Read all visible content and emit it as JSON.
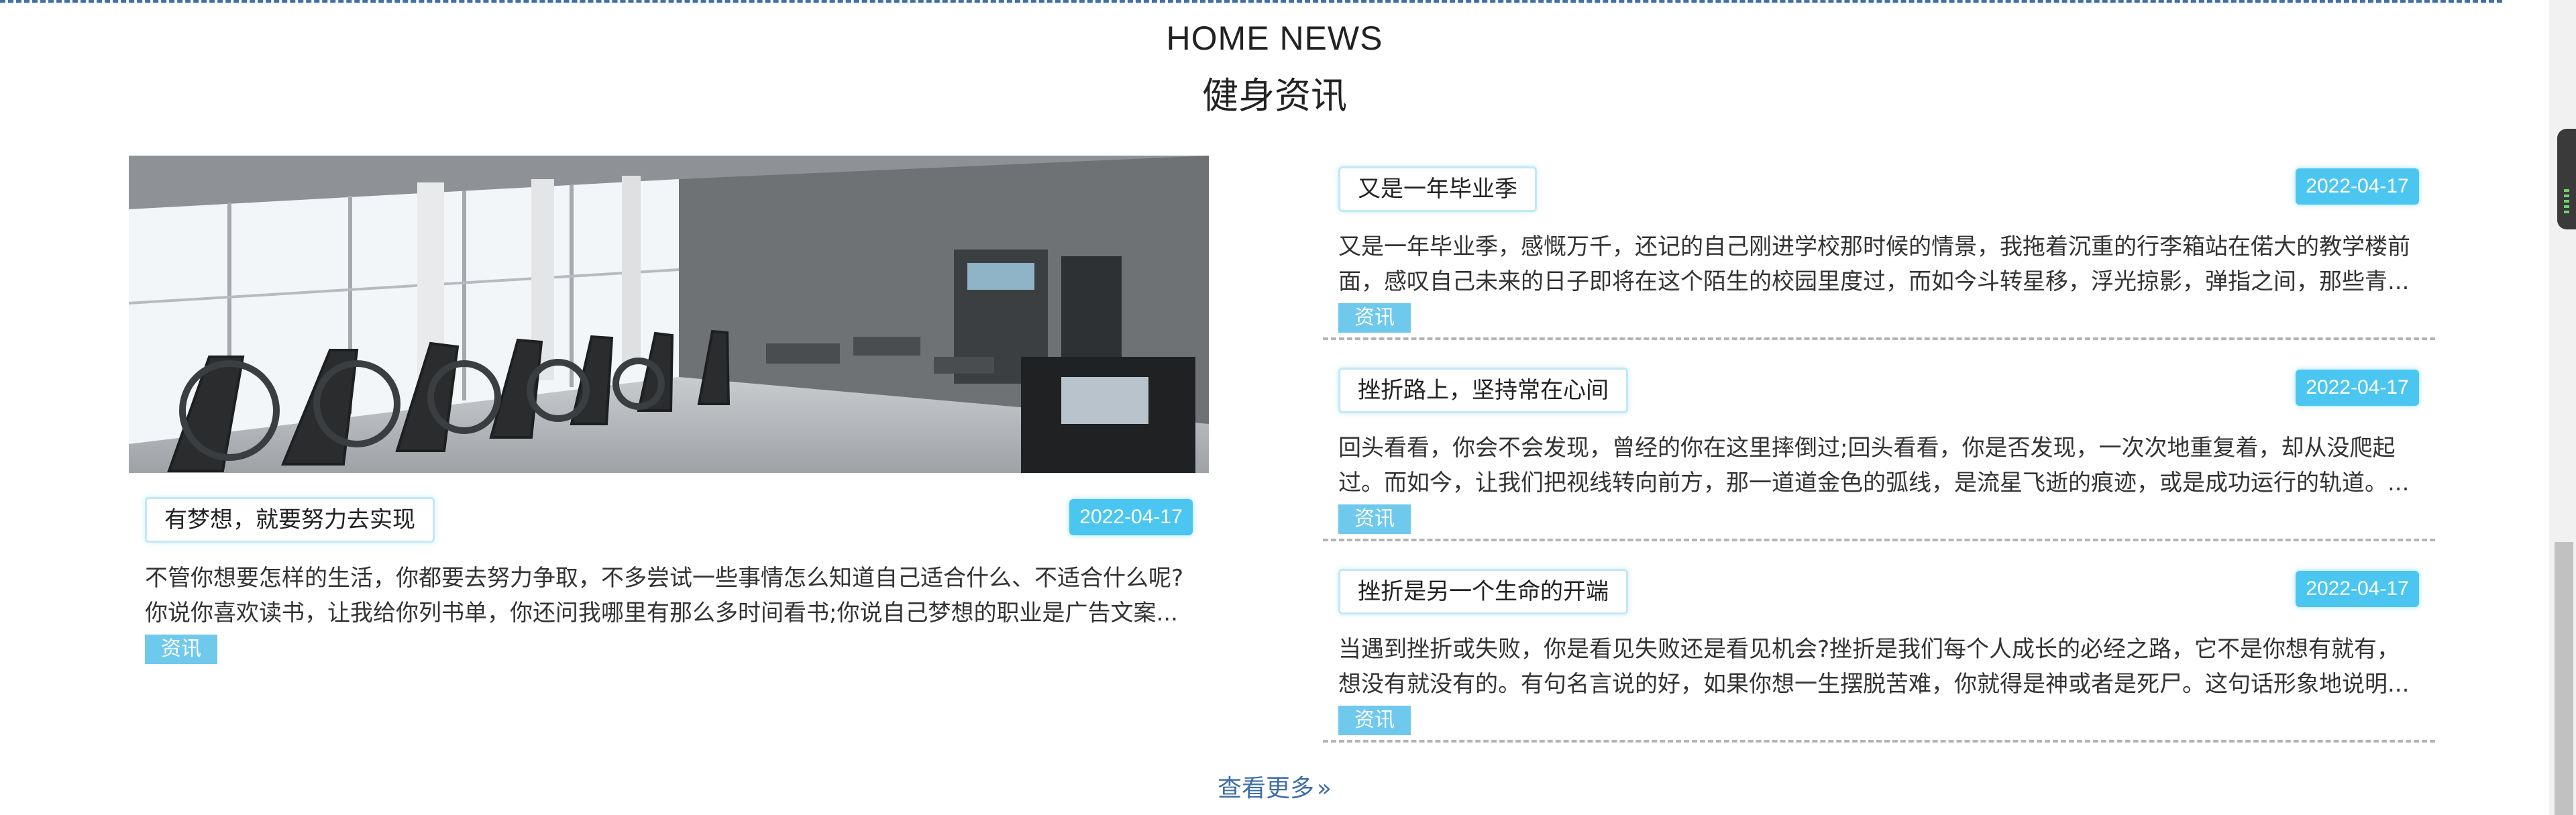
{
  "section": {
    "title_en": "HOME NEWS",
    "title_zh": "健身资讯"
  },
  "featured": {
    "title": "有梦想，就要努力去实现",
    "date": "2022-04-17",
    "summary_line1": "不管你想要怎样的生活，你都要去努力争取，不多尝试一些事情怎么知道自己适合什么、不适合什么呢?",
    "summary_line2": "你说你喜欢读书，让我给你列书单，你还问我哪里有那么多时间看书;你说自己梦想的职业是广告文案...",
    "tag": "资讯"
  },
  "news_items": [
    {
      "title": "又是一年毕业季",
      "date": "2022-04-17",
      "summary_line1": "又是一年毕业季，感慨万千，还记的自己刚进学校那时候的情景，我拖着沉重的行李箱站在偌大的教学楼前",
      "summary_line2": "面，感叹自己未来的日子即将在这个陌生的校园里度过，而如今斗转星移，浮光掠影，弹指之间，那些青...",
      "tag": "资讯"
    },
    {
      "title": "挫折路上，坚持常在心间",
      "date": "2022-04-17",
      "summary_line1": "回头看看，你会不会发现，曾经的你在这里摔倒过;回头看看，你是否发现，一次次地重复着，却从没爬起",
      "summary_line2": "过。而如今，让我们把视线转向前方，那一道道金色的弧线，是流星飞逝的痕迹，或是成功运行的轨道。...",
      "tag": "资讯"
    },
    {
      "title": "挫折是另一个生命的开端",
      "date": "2022-04-17",
      "summary_line1": "当遇到挫折或失败，你是看见失败还是看见机会?挫折是我们每个人成长的必经之路，它不是你想有就有，",
      "summary_line2": "想没有就没有的。有句名言说的好，如果你想一生摆脱苦难，你就得是神或者是死尸。这句话形象地说明...",
      "tag": "资讯"
    }
  ],
  "more_link": {
    "label": "查看更多",
    "icon": "double-chevron-right-icon"
  },
  "colors": {
    "accent_blue": "#4bc6f1",
    "tag_blue": "#6fc9ec",
    "link_blue": "#3d6ea8"
  }
}
